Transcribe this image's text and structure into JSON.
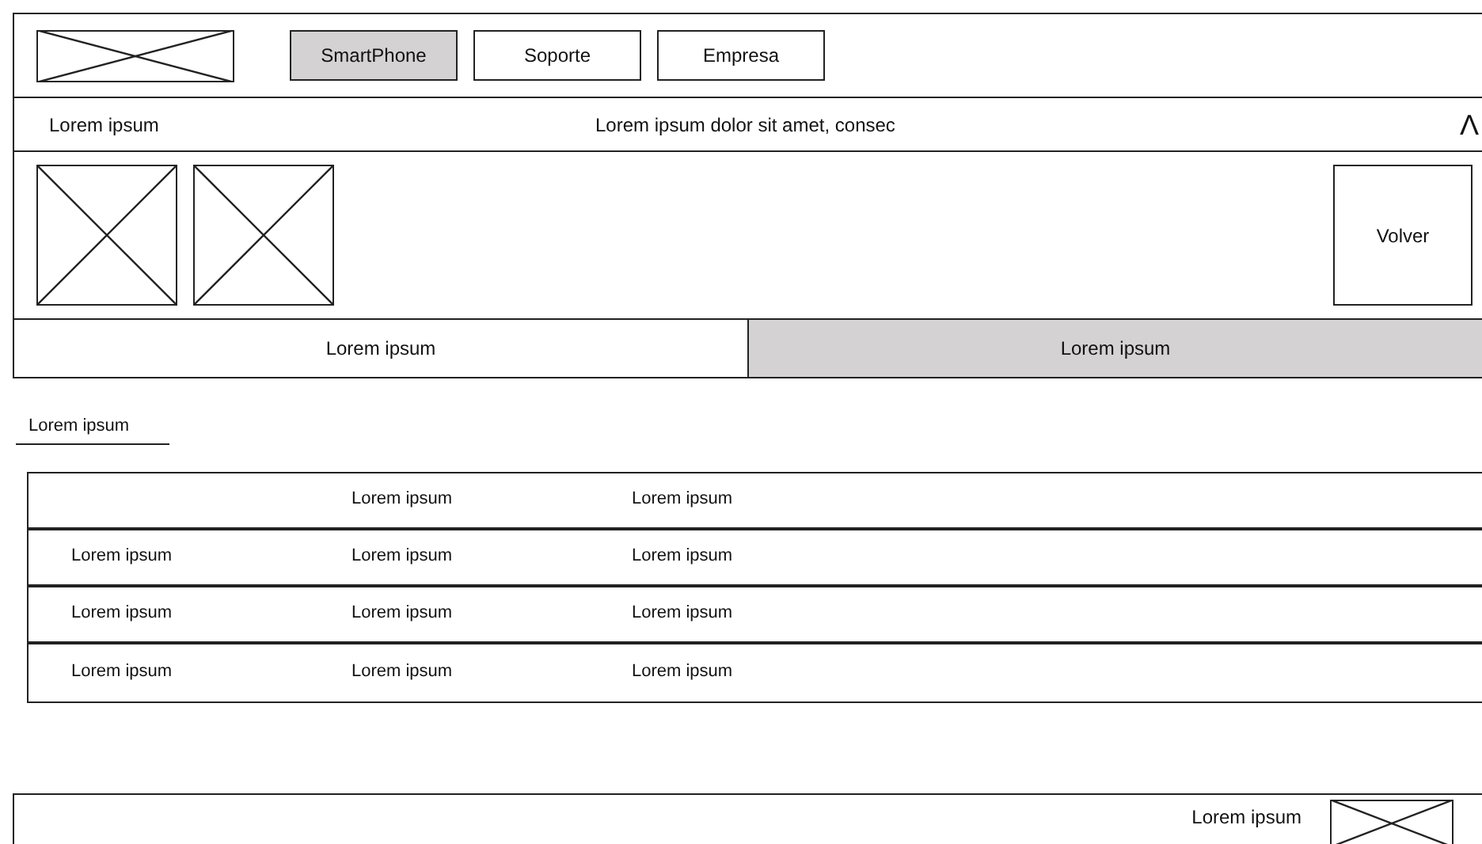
{
  "nav": [
    {
      "label": "SmartPhone",
      "selected": true
    },
    {
      "label": "Soporte",
      "selected": false
    },
    {
      "label": "Empresa",
      "selected": false
    }
  ],
  "info_bar": {
    "left": "Lorem ipsum",
    "center": "Lorem ipsum dolor sit amet, consec",
    "toggle": "Λ"
  },
  "back_button": "Volver",
  "tabs": [
    {
      "label": "Lorem ipsum",
      "selected": false
    },
    {
      "label": "Lorem ipsum",
      "selected": true
    }
  ],
  "section_title": "Lorem ipsum",
  "table": {
    "columns": [
      "",
      "Lorem ipsum",
      "Lorem ipsum"
    ],
    "rows": [
      [
        "Lorem ipsum",
        "Lorem ipsum",
        "Lorem ipsum"
      ],
      [
        "Lorem ipsum",
        "Lorem ipsum",
        "Lorem ipsum"
      ],
      [
        "Lorem ipsum",
        "Lorem ipsum",
        "Lorem ipsum"
      ]
    ]
  },
  "footer": {
    "text": "Lorem ipsum"
  }
}
